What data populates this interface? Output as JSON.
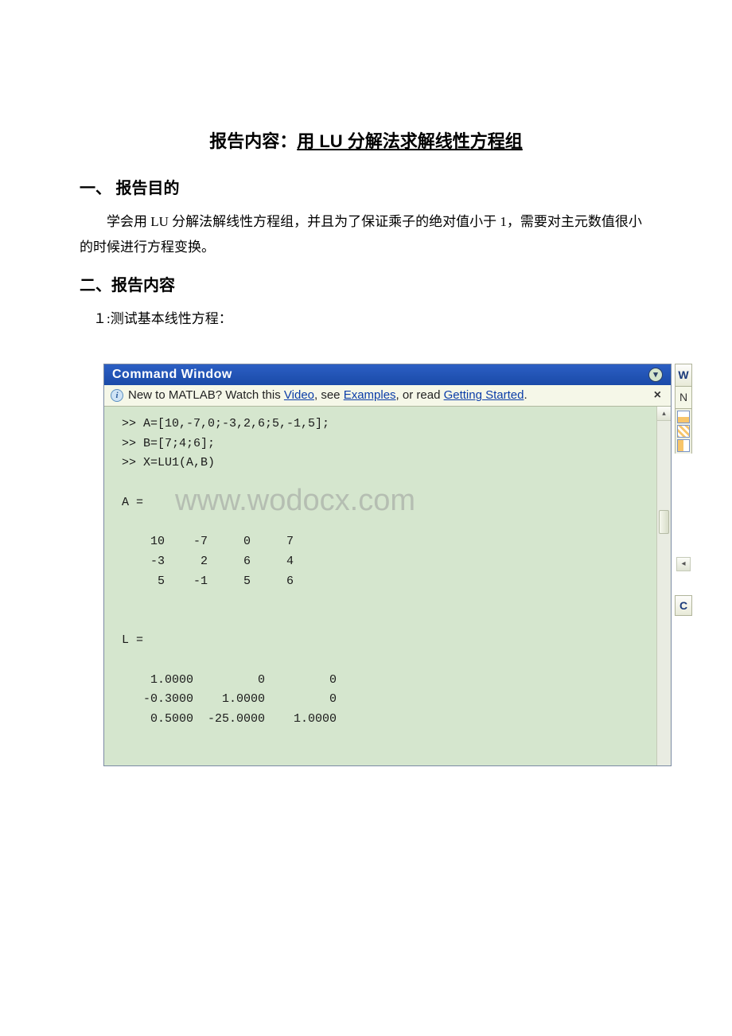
{
  "title": {
    "prefix": "报告内容：",
    "main": "用 LU 分解法求解线性方程组"
  },
  "sections": {
    "s1_heading": "一、 报告目的",
    "s1_body": "学会用 LU 分解法解线性方程组，并且为了保证乘子的绝对值小于 1，需要对主元数值很小的时候进行方程变换。",
    "s2_heading": "二、报告内容",
    "s2_item1": "１:测试基本线性方程："
  },
  "matlab": {
    "title": "Command Window",
    "info_prefix": "New to MATLAB? Watch this ",
    "info_link1": "Video",
    "info_mid1": ", see ",
    "info_link2": "Examples",
    "info_mid2": ", or read ",
    "info_link3": "Getting Started",
    "info_suffix": ".",
    "close": "×",
    "content": ">> A=[10,-7,0;-3,2,6;5,-1,5];\n>> B=[7;4;6];\n>> X=LU1(A,B)\n\nA =\n\n    10    -7     0     7\n    -3     2     6     4\n     5    -1     5     6\n\n\nL =\n\n    1.0000         0         0\n   -0.3000    1.0000         0\n    0.5000  -25.0000    1.0000\n\n"
  },
  "right_strip": {
    "top": "W",
    "n": "N",
    "bottom": "C",
    "arrow": "◂"
  },
  "scrollbar": {
    "up": "▴"
  },
  "watermark": "www.wodocx.com"
}
